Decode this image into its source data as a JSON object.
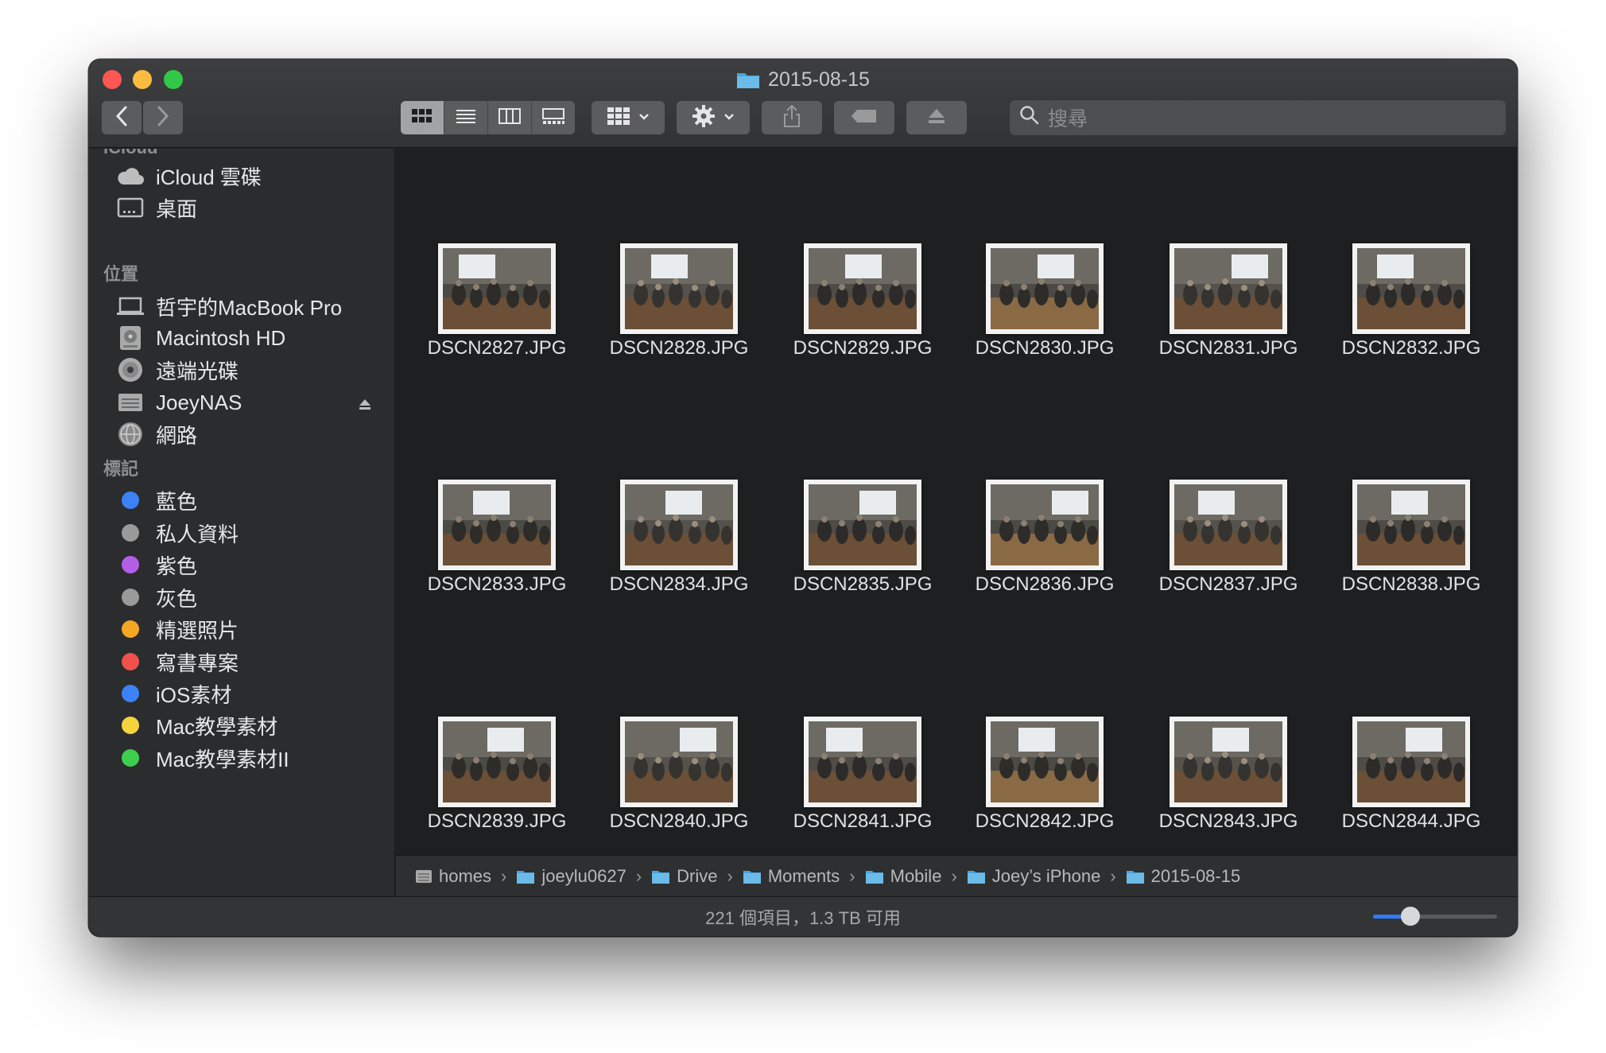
{
  "window": {
    "title": "2015-08-15"
  },
  "toolbar": {
    "view_modes": [
      "icon-view-icon",
      "list-view-icon",
      "column-view-icon",
      "gallery-view-icon"
    ],
    "active_view": 0,
    "search_placeholder": "搜尋"
  },
  "sidebar": {
    "icloud_partial": "iCloud",
    "icloud_items": [
      {
        "label": "iCloud 雲碟",
        "icon": "cloud-icon"
      },
      {
        "label": "桌面",
        "icon": "desktop-icon"
      }
    ],
    "locations_header": "位置",
    "locations": [
      {
        "label": "哲宇的MacBook Pro",
        "icon": "laptop-icon"
      },
      {
        "label": "Macintosh HD",
        "icon": "hard-drive-icon"
      },
      {
        "label": "遠端光碟",
        "icon": "disc-icon"
      },
      {
        "label": "JoeyNAS",
        "icon": "server-icon"
      },
      {
        "label": "網路",
        "icon": "network-icon"
      }
    ],
    "tags_header": "標記",
    "tags": [
      {
        "label": "藍色",
        "color": "#3b82f6"
      },
      {
        "label": "私人資料",
        "color": "#9a9a9a"
      },
      {
        "label": "紫色",
        "color": "#b45ee8"
      },
      {
        "label": "灰色",
        "color": "#9a9a9a"
      },
      {
        "label": "精選照片",
        "color": "#f5a623"
      },
      {
        "label": "寫書專案",
        "color": "#f0514a"
      },
      {
        "label": "iOS素材",
        "color": "#3b82f6"
      },
      {
        "label": "Mac教學素材",
        "color": "#f5d33c"
      },
      {
        "label": "Mac教學素材II",
        "color": "#3ccf4e"
      }
    ]
  },
  "files": [
    "DSCN2827.JPG",
    "DSCN2828.JPG",
    "DSCN2829.JPG",
    "DSCN2830.JPG",
    "DSCN2831.JPG",
    "DSCN2832.JPG",
    "DSCN2833.JPG",
    "DSCN2834.JPG",
    "DSCN2835.JPG",
    "DSCN2836.JPG",
    "DSCN2837.JPG",
    "DSCN2838.JPG",
    "DSCN2839.JPG",
    "DSCN2840.JPG",
    "DSCN2841.JPG",
    "DSCN2842.JPG",
    "DSCN2843.JPG",
    "DSCN2844.JPG"
  ],
  "pathbar": [
    {
      "label": "homes",
      "icon": "server-icon"
    },
    {
      "label": "joeylu0627",
      "icon": "folder-icon"
    },
    {
      "label": "Drive",
      "icon": "folder-icon"
    },
    {
      "label": "Moments",
      "icon": "folder-icon"
    },
    {
      "label": "Mobile",
      "icon": "folder-icon"
    },
    {
      "label": "Joey’s iPhone",
      "icon": "folder-icon"
    },
    {
      "label": "2015-08-15",
      "icon": "folder-icon"
    }
  ],
  "status": {
    "text": "221 個項目，1.3 TB 可用"
  },
  "icon_size_slider": {
    "value": 0.3
  }
}
